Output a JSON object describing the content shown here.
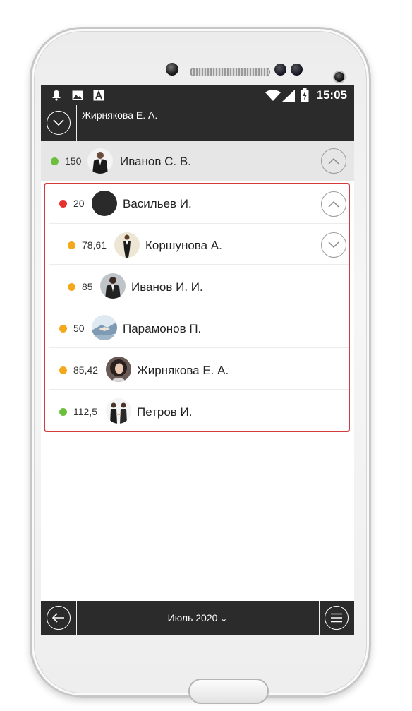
{
  "status_bar": {
    "time": "15:05",
    "icons": [
      "bell-icon",
      "image-icon",
      "a-icon",
      "wifi-icon",
      "signal-icon",
      "battery-icon"
    ]
  },
  "header": {
    "title": "Жирнякова Е. А."
  },
  "group": {
    "dot_color": "#6cbf3c",
    "value": "150",
    "name": "Иванов С. В."
  },
  "rows": [
    {
      "dot_color": "#e5322f",
      "value": "20",
      "name": "Васильев И.",
      "chevron": "up"
    },
    {
      "dot_color": "#f4a91c",
      "value": "78,61",
      "name": "Коршунова А.",
      "chevron": "down"
    },
    {
      "dot_color": "#f4a91c",
      "value": "85",
      "name": "Иванов И. И."
    },
    {
      "dot_color": "#f4a91c",
      "value": "50",
      "name": "Парамонов П."
    },
    {
      "dot_color": "#f4a91c",
      "value": "85,42",
      "name": "Жирнякова Е. А."
    },
    {
      "dot_color": "#6cbf3c",
      "value": "112,5",
      "name": "Петров И."
    }
  ],
  "footer": {
    "month": "Июль 2020",
    "dropdown_glyph": "⌄"
  },
  "colors": {
    "bar": "#2b2b2b",
    "highlight_border": "#d63b3b"
  }
}
